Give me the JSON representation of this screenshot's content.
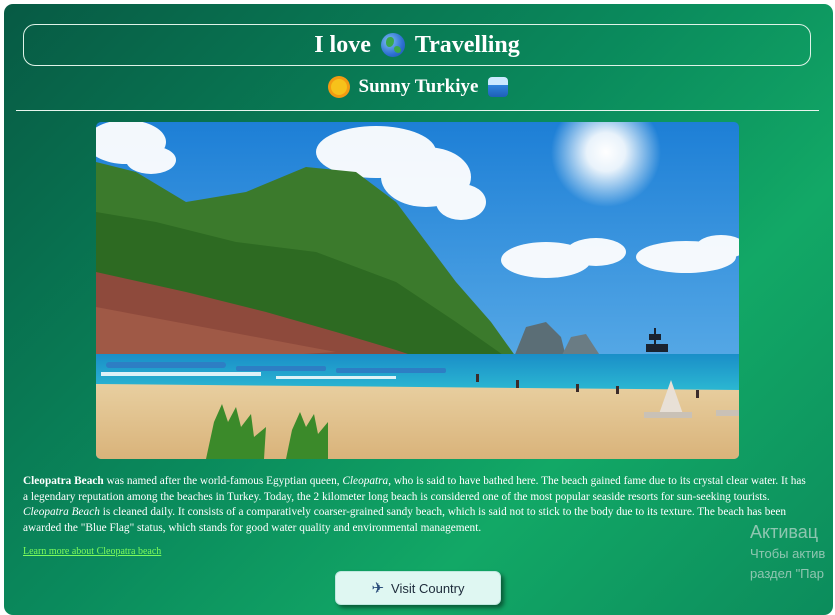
{
  "header": {
    "title_pre": "I love",
    "title_icon": "globe-icon",
    "title_post": "Travelling",
    "subtitle": "Sunny Turkiye",
    "subtitle_icon_left": "sun-icon",
    "subtitle_icon_right": "wave-icon"
  },
  "article": {
    "name": "Cleopatra Beach",
    "text_1": " was named after the world-famous Egyptian queen, ",
    "queen": "Cleopatra",
    "text_2": ", who is said to have bathed here. The beach gained fame due to its crystal clear water. It has a legendary reputation among the beaches in Turkey. Today, the 2 kilometer long beach is considered one of the most popular seaside resorts for sun-seeking tourists. ",
    "name_italic": "Cleopatra Beach",
    "text_3": " is cleaned daily. It consists of a comparatively coarser-grained sandy beach, which is said not to stick to the body due to its texture. The beach has been awarded the \"Blue Flag\" status, which stands for good water quality and environmental management.",
    "link_label": "Learn more about Cleopatra beach"
  },
  "cta": {
    "label": "Visit Country",
    "icon": "airplane-icon"
  },
  "watermark": {
    "title": "Активац",
    "line1": "Чтобы актив",
    "line2": "раздел \"Пар"
  },
  "colors": {
    "accent_gradient_start": "#075a44",
    "accent_gradient_end": "#12a866",
    "link": "#7dfc5c",
    "button_bg": "#dff7f2"
  }
}
